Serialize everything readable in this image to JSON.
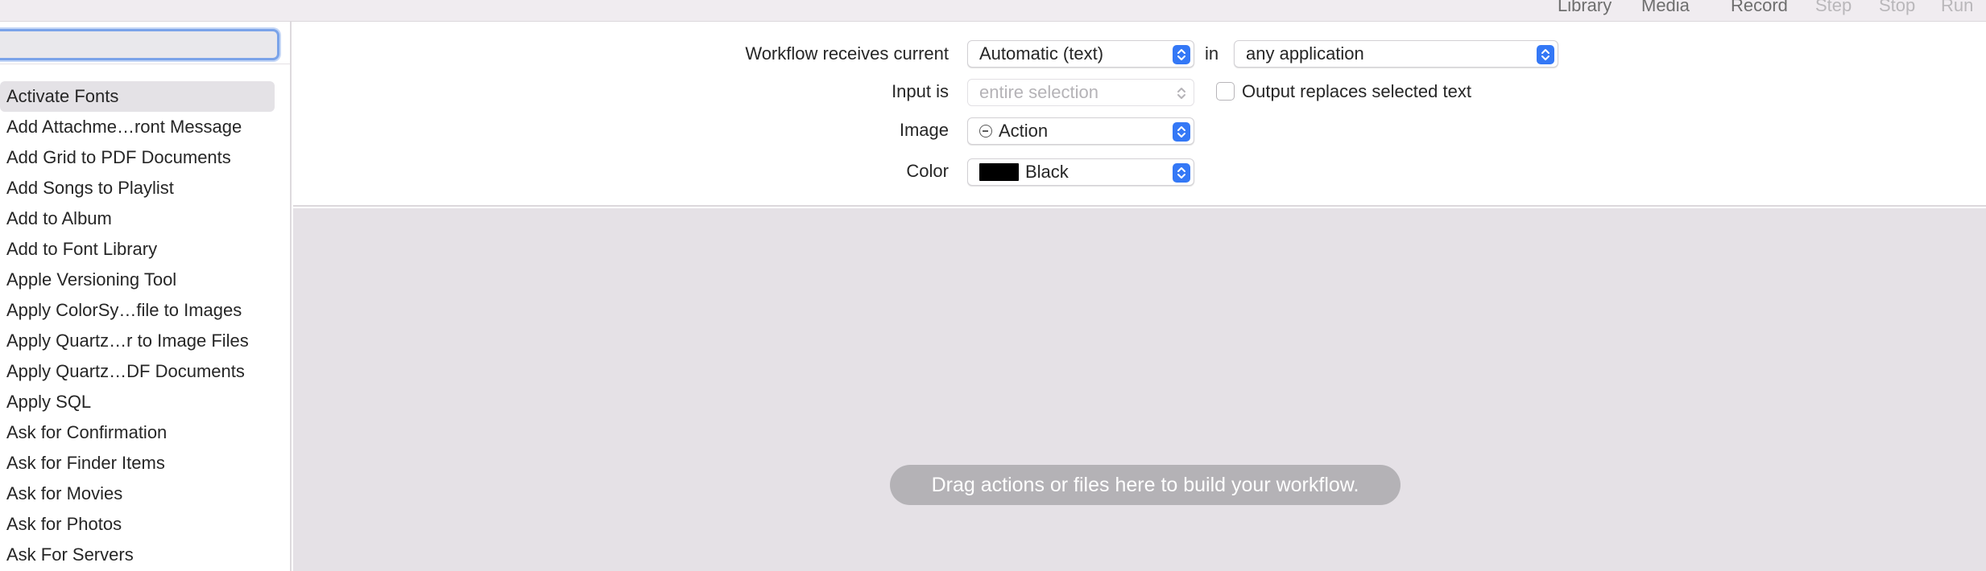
{
  "toolbar": {
    "library": "Library",
    "media": "Media",
    "record": "Record",
    "step": "Step",
    "stop": "Stop",
    "run": "Run"
  },
  "sidebar": {
    "search": {
      "value": "",
      "placeholder": ""
    },
    "actions": [
      "Activate Fonts",
      "Add Attachme…ront Message",
      "Add Grid to PDF Documents",
      "Add Songs to Playlist",
      "Add to Album",
      "Add to Font Library",
      "Apple Versioning Tool",
      "Apply ColorSy…file to Images",
      "Apply Quartz…r to Image Files",
      "Apply Quartz…DF Documents",
      "Apply SQL",
      "Ask for Confirmation",
      "Ask for Finder Items",
      "Ask for Movies",
      "Ask for Photos",
      "Ask For Servers"
    ],
    "selected_index": 0
  },
  "settings": {
    "receives_label": "Workflow receives current",
    "receives_value": "Automatic (text)",
    "in_label": "in",
    "application_value": "any application",
    "input_label": "Input is",
    "input_value": "entire selection",
    "output_replaces_label": "Output replaces selected text",
    "output_replaces_checked": false,
    "image_label": "Image",
    "image_value": "Action",
    "color_label": "Color",
    "color_value": "Black",
    "color_swatch": "#000000"
  },
  "canvas": {
    "hint": "Drag actions or files here to build your workflow."
  },
  "colors": {
    "accent": "#3478f6",
    "canvas_bg": "#e5e1e6",
    "selection_bg": "#e4e2e6"
  }
}
